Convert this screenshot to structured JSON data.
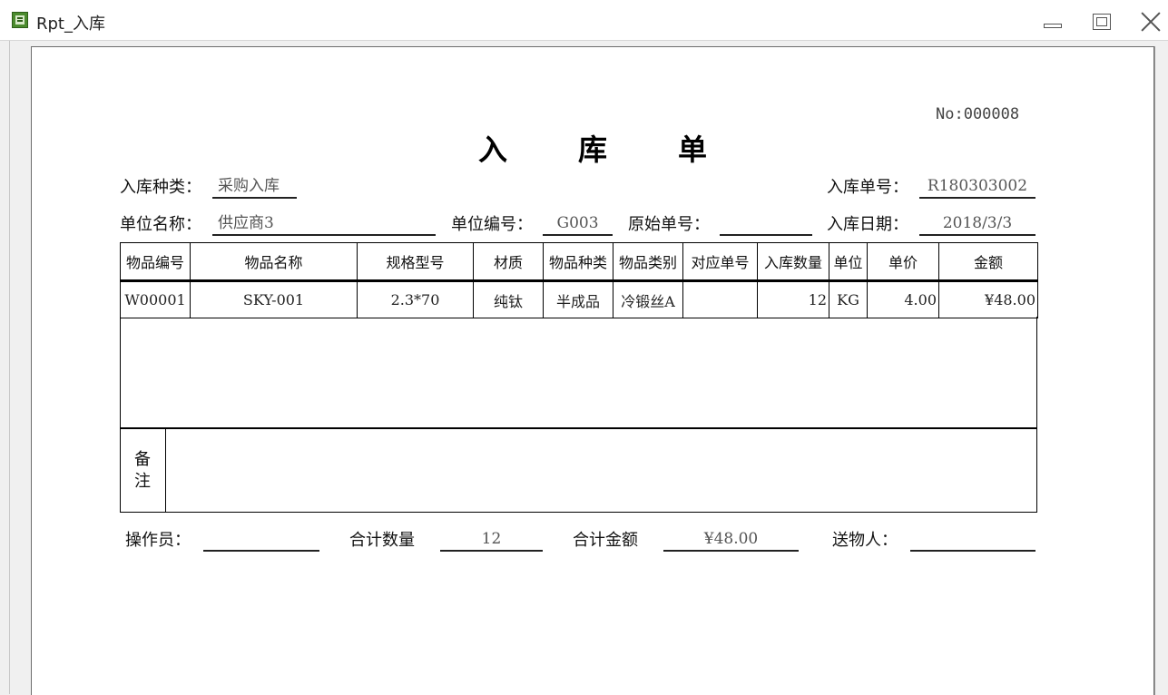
{
  "window": {
    "title": "Rpt_入库"
  },
  "report": {
    "serial": "No:000008",
    "title": "入库单",
    "fields": {
      "type_label": "入库种类：",
      "type_value": "采购入库",
      "order_no_label": "入库单号：",
      "order_no_value": "R180303002",
      "unit_name_label": "单位名称：",
      "unit_name_value": "供应商3",
      "unit_code_label": "单位编号：",
      "unit_code_value": "G003",
      "orig_no_label": "原始单号：",
      "orig_no_value": "",
      "date_label": "入库日期：",
      "date_value": "2018/3/3"
    },
    "table": {
      "headers": [
        "物品编号",
        "物品名称",
        "规格型号",
        "材质",
        "物品种类",
        "物品类别",
        "对应单号",
        "入库数量",
        "单位",
        "单价",
        "金额"
      ],
      "rows": [
        [
          "W00001",
          "SKY-001",
          "2.3*70",
          "纯钛",
          "半成品",
          "冷锻丝A",
          "",
          "12",
          "KG",
          "4.00",
          "¥48.00"
        ]
      ]
    },
    "remark_label": "备\n注",
    "remark_value": "",
    "footer": {
      "operator_label": "操作员：",
      "operator_value": "",
      "total_qty_label": "合计数量",
      "total_qty_value": "12",
      "total_amount_label": "合计金额",
      "total_amount_value": "¥48.00",
      "sender_label": "送物人：",
      "sender_value": ""
    }
  }
}
